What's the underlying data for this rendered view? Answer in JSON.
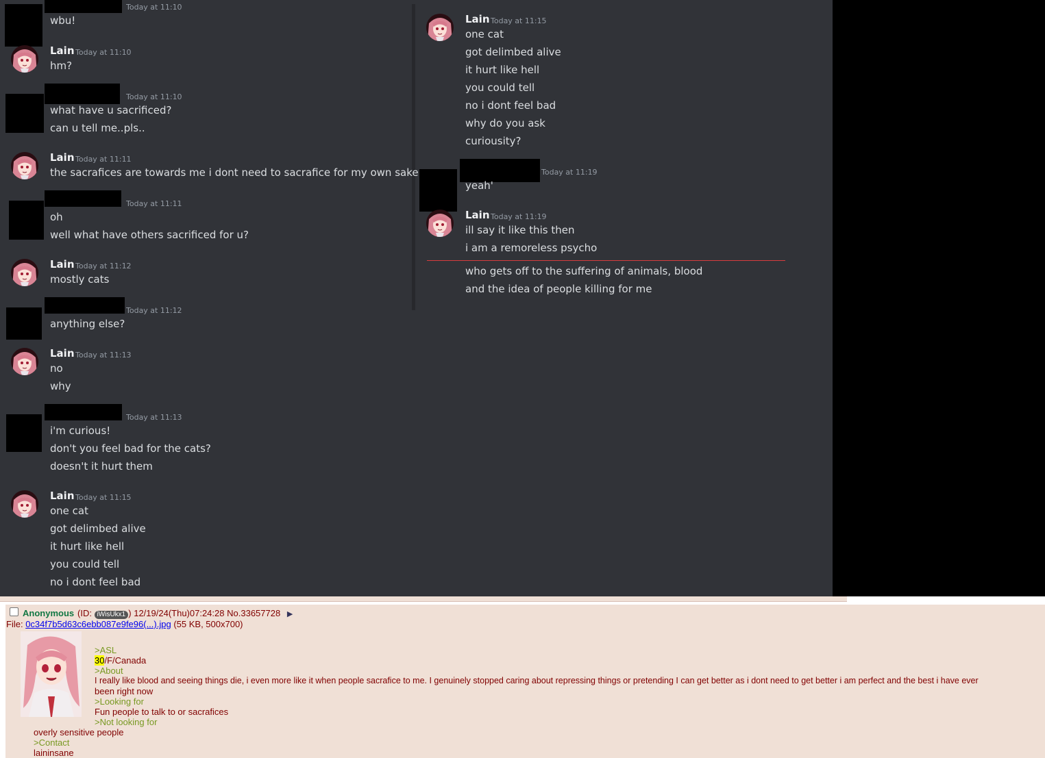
{
  "chat_left": {
    "messages": [
      {
        "author": "",
        "redacted": true,
        "time": "Today at 11:10",
        "lines": [
          "wbu!"
        ]
      },
      {
        "author": "Lain",
        "time": "Today at 11:10",
        "lines": [
          "hm?"
        ]
      },
      {
        "author": "",
        "redacted": true,
        "time": "Today at 11:10",
        "lines": [
          "what have u sacrificed?",
          "can u tell me..pls.."
        ]
      },
      {
        "author": "Lain",
        "time": "Today at 11:11",
        "lines": [
          "the sacrafices are towards me i dont need to sacrafice for my own sake"
        ]
      },
      {
        "author": "",
        "redacted": true,
        "time": "Today at 11:11",
        "lines": [
          "oh",
          "well what have others sacrificed for u?"
        ]
      },
      {
        "author": "Lain",
        "time": "Today at 11:12",
        "lines": [
          "mostly cats"
        ]
      },
      {
        "author": "",
        "redacted": true,
        "time": "Today at 11:12",
        "lines": [
          "anything else?"
        ]
      },
      {
        "author": "Lain",
        "time": "Today at 11:13",
        "lines": [
          "no",
          "why"
        ]
      },
      {
        "author": "",
        "redacted": true,
        "time": "Today at 11:13",
        "lines": [
          "i'm curious!",
          "don't you feel bad for the cats?",
          "doesn't it hurt them"
        ]
      },
      {
        "author": "Lain",
        "time": "Today at 11:15",
        "lines": [
          "one cat",
          "got delimbed alive",
          "it hurt like hell",
          "you could tell",
          "no i dont feel bad"
        ]
      }
    ]
  },
  "chat_right": {
    "messages": [
      {
        "author": "Lain",
        "time": "Today at 11:15",
        "lines": [
          "one cat",
          "got delimbed alive",
          "it hurt like hell",
          "you could tell",
          "no i dont feel bad",
          "why do you ask",
          "curiousity?"
        ]
      },
      {
        "author": "",
        "redacted": true,
        "time": "Today at 11:19",
        "lines": [
          "yeah'"
        ]
      },
      {
        "author": "Lain",
        "time": "Today at 11:19",
        "lines": [
          "ill say it like this then",
          "i am a remoreless psycho"
        ]
      }
    ],
    "after_separator": [
      "who gets off to the suffering of animals, blood",
      "and the idea of people killing for me"
    ]
  },
  "post": {
    "name": "Anonymous",
    "id_prefix": "(ID:",
    "id": "iWisUkx1",
    "id_suffix": ")",
    "datetime": "12/19/24(Thu)07:24:28",
    "number": "No.33657728",
    "file_label": "File:",
    "file_name": "0c34f7b5d63c6ebb087e9fe96(...).jpg",
    "file_meta": "(55 KB, 500x700)",
    "body": {
      "asl_label": ">ASL",
      "age": "30",
      "asl_rest": "/F/Canada",
      "about_label": ">About",
      "about_line1": "I really like blood and seeing things die, i even more like it when people sacrafice to me. I genuinely stopped caring about repressing things or pretending I can get better as i dont need to get better i am perfect and the best i have ever",
      "about_line2": "been right now",
      "looking_label": ">Looking for",
      "looking_text": "Fun people to talk to or sacrafices",
      "not_looking_label": ">Not looking for",
      "not_looking_text": "overly sensitive people",
      "contact_label": ">Contact",
      "contact_text": "laininsane"
    }
  },
  "colors": {
    "discord_bg": "#313338",
    "text": "#dbdee1",
    "timestamp": "#949ba4",
    "new_messages_line": "#d83c3e",
    "post_bg": "#f0e0d6",
    "greentext": "#789922",
    "post_text": "#800000"
  }
}
